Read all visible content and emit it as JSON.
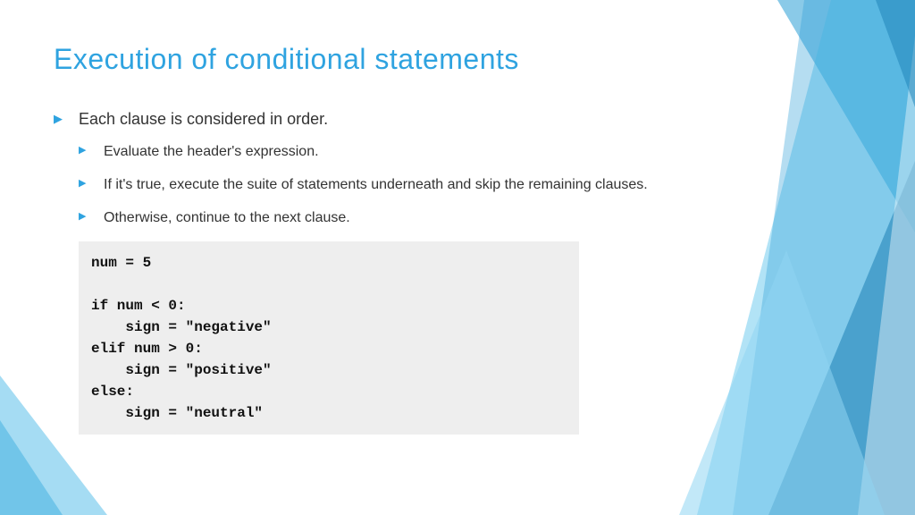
{
  "title": "Execution of conditional statements",
  "bullets": {
    "main": "Each clause is considered in order.",
    "sub": [
      "Evaluate the header's expression.",
      "If it's true, execute the suite of statements underneath and skip the remaining clauses.",
      "Otherwise, continue to the next clause."
    ]
  },
  "code": "num = 5\n\nif num < 0:\n    sign = \"negative\"\nelif num > 0:\n    sign = \"positive\"\nelse:\n    sign = \"neutral\""
}
